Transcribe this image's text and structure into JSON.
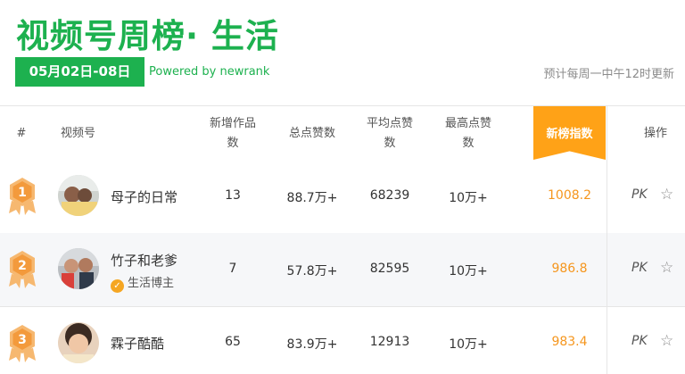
{
  "header": {
    "title": "视频号周榜· 生活",
    "date_range": "05月02日-08日",
    "powered_by": "Powered by newrank",
    "update_note": "预计每周一中午12时更新"
  },
  "colors": {
    "brand_green": "#1db14f",
    "highlight_orange": "#ffa217",
    "index_value": "#f5961e",
    "medal": "#f6b870"
  },
  "table": {
    "columns": {
      "index": "#",
      "account": "视频号",
      "new_works": [
        "新增作品",
        "数"
      ],
      "total_likes": "总点赞数",
      "avg_likes": [
        "平均点赞",
        "数"
      ],
      "max_likes": [
        "最高点赞",
        "数"
      ],
      "rank_index": "新榜指数",
      "action": "操作"
    },
    "rows": [
      {
        "rank": "1",
        "name": "母子的日常",
        "badge": "",
        "new_works": "13",
        "total_likes": "88.7万+",
        "avg_likes": "68239",
        "max_likes": "10万+",
        "rank_index": "1008.2",
        "pk": "PK",
        "icon": "star-outline-icon"
      },
      {
        "rank": "2",
        "name": "竹子和老爹",
        "badge": "生活博主",
        "new_works": "7",
        "total_likes": "57.8万+",
        "avg_likes": "82595",
        "max_likes": "10万+",
        "rank_index": "986.8",
        "pk": "PK",
        "icon": "star-outline-icon"
      },
      {
        "rank": "3",
        "name": "霖子酷酷",
        "badge": "",
        "new_works": "65",
        "total_likes": "83.9万+",
        "avg_likes": "12913",
        "max_likes": "10万+",
        "rank_index": "983.4",
        "pk": "PK",
        "icon": "star-outline-icon"
      }
    ]
  }
}
